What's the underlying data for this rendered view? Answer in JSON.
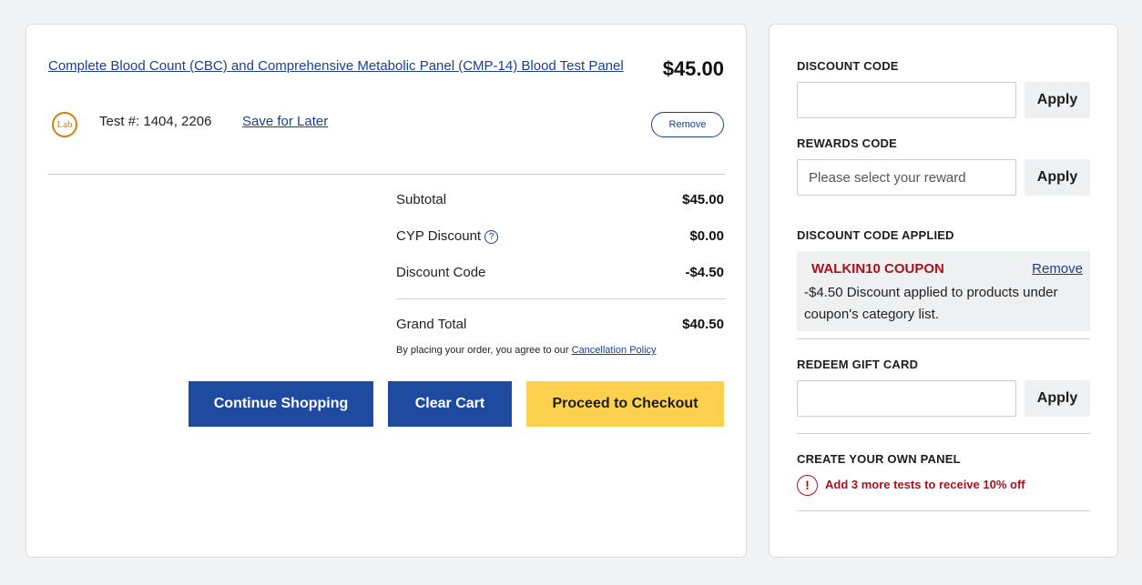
{
  "cart": {
    "product_name": "Complete Blood Count (CBC) and Comprehensive Metabolic Panel (CMP-14) Blood Test Panel",
    "price": "$45.00",
    "lab_icon_text": "Lab",
    "test_number": "Test #: 1404, 2206",
    "save_for_later": "Save for Later",
    "remove_label": "Remove"
  },
  "summary": {
    "subtotal_label": "Subtotal",
    "subtotal_value": "$45.00",
    "cyp_label": "CYP Discount",
    "cyp_value": "$0.00",
    "help_icon_glyph": "?",
    "discount_label": "Discount Code",
    "discount_value": "-$4.50",
    "grand_total_label": "Grand Total",
    "grand_total_value": "$40.50",
    "agree_text": "By placing your order, you agree to our",
    "cancellation_link": "Cancellation Policy"
  },
  "buttons": {
    "continue_shopping": "Continue Shopping",
    "clear_cart": "Clear Cart",
    "checkout": "Proceed to Checkout"
  },
  "sidebar": {
    "discount_code_title": "DISCOUNT CODE",
    "discount_code_value": "",
    "rewards_code_title": "REWARDS CODE",
    "rewards_placeholder": "Please select your reward",
    "apply_label": "Apply",
    "discount_applied_title": "DISCOUNT CODE APPLIED",
    "coupon_name": "WALKIN10 COUPON",
    "coupon_remove": "Remove",
    "coupon_desc": "-$4.50  Discount applied to products under coupon's category list.",
    "gift_card_title": "REDEEM GIFT CARD",
    "gift_card_value": "",
    "panel_title": "CREATE YOUR OWN PANEL",
    "panel_warning": "Add 3 more tests to receive 10% off",
    "warning_glyph": "!"
  },
  "colors": {
    "brand_blue": "#1e4aa0",
    "link_blue": "#1e3e8c",
    "checkout_yellow": "#fdd14e",
    "alert_red": "#a8121b",
    "lab_orange": "#d27f0e"
  },
  "icons": [
    "lab-icon",
    "help-icon",
    "warning-icon"
  ]
}
